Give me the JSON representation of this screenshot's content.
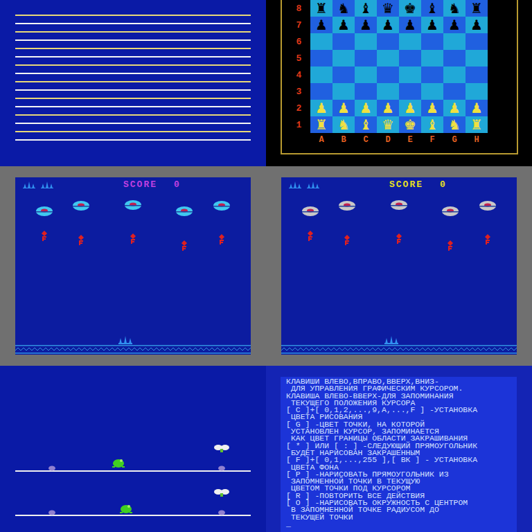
{
  "chess": {
    "files": [
      "A",
      "B",
      "C",
      "D",
      "E",
      "F",
      "G",
      "H"
    ],
    "board": [
      {
        "rank": "8",
        "side": "black",
        "squares": [
          "♜",
          "♞",
          "♝",
          "♛",
          "♚",
          "♝",
          "♞",
          "♜"
        ]
      },
      {
        "rank": "7",
        "side": "black",
        "squares": [
          "♟",
          "♟",
          "♟",
          "♟",
          "♟",
          "♟",
          "♟",
          "♟"
        ]
      },
      {
        "rank": "6",
        "side": "none",
        "squares": [
          "",
          "",
          "",
          "",
          "",
          "",
          "",
          ""
        ]
      },
      {
        "rank": "5",
        "side": "none",
        "squares": [
          "",
          "",
          "",
          "",
          "",
          "",
          "",
          ""
        ]
      },
      {
        "rank": "4",
        "side": "none",
        "squares": [
          "",
          "",
          "",
          "",
          "",
          "",
          "",
          ""
        ]
      },
      {
        "rank": "3",
        "side": "none",
        "squares": [
          "",
          "",
          "",
          "",
          "",
          "",
          "",
          ""
        ]
      },
      {
        "rank": "2",
        "side": "yellow",
        "squares": [
          "♟",
          "♟",
          "♟",
          "♟",
          "♟",
          "♟",
          "♟",
          "♟"
        ]
      },
      {
        "rank": "1",
        "side": "yellow",
        "squares": [
          "♜",
          "♞",
          "♝",
          "♛",
          "♚",
          "♝",
          "♞",
          "♜"
        ]
      }
    ]
  },
  "games": [
    {
      "score_label": "SCORE",
      "score": "0",
      "score_color": "#c040e0",
      "saucer_color": "#40c8f0",
      "lives": 2
    },
    {
      "score_label": "SCORE",
      "score": "0",
      "score_color": "#e8e020",
      "saucer_color": "#c8c8c8",
      "lives": 2
    }
  ],
  "help_text": {
    "lines": [
      "КЛАВИШИ ВЛЕВО,ВПРАВО,ВВЕРХ,ВНИЗ-",
      " ДЛЯ УПРАВЛЕНИЯ ГРАФИЧЕСКИМ КУРСОРОМ.",
      "КЛАВИША ВЛЕВО-ВВЕРХ-ДЛЯ ЗАПОМИНАНИЯ",
      " ТЕКУЩЕГО ПОЛОЖЕНИЯ КУРСОРА",
      "[ C ]+[ 0,1,2,...,9,A,...,F ] -УСТАНОВКА",
      " ЦВЕТА РИСОВАНИЯ",
      "[ G ] -ЦВЕТ ТОЧКИ, НА КОТОРОЙ",
      " УСТАНОВЛЕН КУРСОР, ЗАПОМИНАЕТСЯ",
      " КАК ЦВЕТ ГРАНИЦЫ ОБЛАСТИ ЗАКРАШИВАНИЯ",
      "[ * ] ИЛИ [ : ] -СЛЕДУЮЩИЙ ПРЯМОУГОЛЬНИК",
      " БУДЕТ НАРИСОВАН ЗАКРАШЕННЫМ",
      "[ F ]+[ 0,1,...,255 ],[ ВК ] - УСТАНОВКА",
      " ЦВЕТА ФОНА",
      "[ P ] -НАРИСОВАТЬ ПРЯМОУГОЛЬНИК ИЗ",
      " ЗАПОМНЕННОЙ ТОЧКИ В ТЕКУЩУЮ",
      " ЦВЕТОМ ТОЧКИ ПОД КУРСОРОМ",
      "[ R ] -ПОВТОРИТЬ ВСЕ ДЕЙСТВИЯ",
      "[ O ] -НАРИСОВАТЬ ОКРУЖНОСТЬ С ЦЕНТРОМ",
      " В ЗАПОМНЕННОЙ ТОЧКЕ РАДИУСОМ ДО",
      " ТЕКУЩЕЙ ТОЧКИ"
    ],
    "cursor": "_"
  }
}
